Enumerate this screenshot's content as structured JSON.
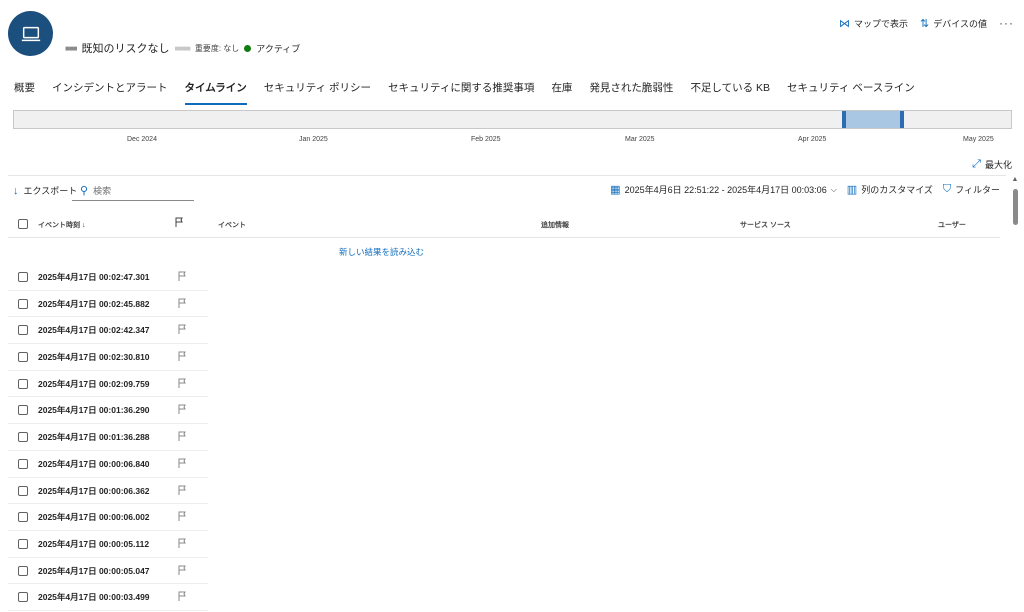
{
  "header": {
    "risk_label": "既知のリスクなし",
    "severity": "重要度: なし",
    "status": "アクティブ",
    "status_color": "#107c10",
    "avatar_color": "#1b4f7e",
    "avatar_icon": "laptop-icon"
  },
  "top_actions": {
    "map_label": "マップで表示",
    "device_value_label": "デバイスの値",
    "more_label": "···"
  },
  "tabs": [
    {
      "label": "概要"
    },
    {
      "label": "インシデントとアラート"
    },
    {
      "label": "タイムライン",
      "active": true
    },
    {
      "label": "セキュリティ ポリシー"
    },
    {
      "label": "セキュリティに関する推奨事項"
    },
    {
      "label": "在庫"
    },
    {
      "label": "発見された脆弱性"
    },
    {
      "label": "不足している KB"
    },
    {
      "label": "セキュリティ ベースライン"
    }
  ],
  "timeline": {
    "months": [
      "Dec 2024",
      "Jan 2025",
      "Feb 2025",
      "Mar 2025",
      "Apr 2025",
      "May 2025"
    ],
    "selection_color": "#a9c7e2"
  },
  "maximize_label": "最大化",
  "toolbar": {
    "export_label": "エクスポート",
    "search_placeholder": "検索",
    "date_range": "2025年4月6日 22:51:22 - 2025年4月17日 00:03:06",
    "customize_columns_label": "列のカスタマイズ",
    "filter_label": "フィルター"
  },
  "table": {
    "columns": {
      "time": "イベント時刻 ↓",
      "event": "イベント",
      "info": "追加情報",
      "service": "サービス ソース",
      "user": "ユーザー"
    },
    "load_more": "新しい結果を読み込む",
    "rows": [
      "2025年4月17日 00:02:47.301",
      "2025年4月17日 00:02:45.882",
      "2025年4月17日 00:02:42.347",
      "2025年4月17日 00:02:30.810",
      "2025年4月17日 00:02:09.759",
      "2025年4月17日 00:01:36.290",
      "2025年4月17日 00:01:36.288",
      "2025年4月17日 00:00:06.840",
      "2025年4月17日 00:00:06.362",
      "2025年4月17日 00:00:06.002",
      "2025年4月17日 00:00:05.112",
      "2025年4月17日 00:00:05.047",
      "2025年4月17日 00:00:03.499"
    ]
  },
  "accent_color": "#0f6cbd"
}
